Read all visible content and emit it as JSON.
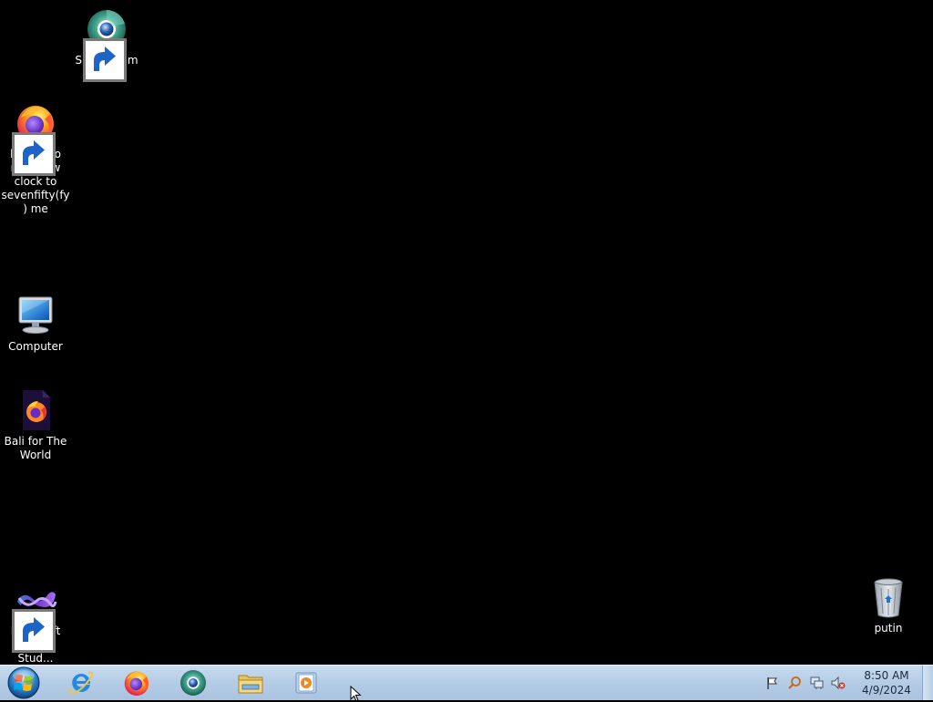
{
  "desktop": {
    "background_color": "#000000",
    "icons": [
      {
        "label": "Supermium",
        "icon": "supermium-icon",
        "shortcut": true
      },
      {
        "label": "haha i do not allow clock to sevenfifty(fy) me",
        "icon": "firefox-icon",
        "shortcut": true
      },
      {
        "label": "Computer",
        "icon": "computer-icon",
        "shortcut": false
      },
      {
        "label": "Bali for The World",
        "icon": "firefox-document-icon",
        "shortcut": false
      },
      {
        "label": "Microsoft Visual Stud...",
        "icon": "visual-studio-icon",
        "shortcut": true
      },
      {
        "label": "putin",
        "icon": "recycle-bin-icon",
        "shortcut": false
      }
    ]
  },
  "taskbar": {
    "start_icon": "windows-start-orb-icon",
    "pinned": [
      {
        "name": "internet-explorer",
        "icon": "internet-explorer-icon"
      },
      {
        "name": "firefox",
        "icon": "firefox-icon"
      },
      {
        "name": "supermium",
        "icon": "supermium-icon"
      },
      {
        "name": "windows-explorer",
        "icon": "folder-icon"
      },
      {
        "name": "media-player",
        "icon": "media-player-icon"
      }
    ],
    "tray": {
      "icons": [
        "action-center-flag-icon",
        "search-icon",
        "network-icon",
        "volume-muted-icon"
      ]
    },
    "clock": {
      "time": "8:50 AM",
      "date": "4/9/2024"
    }
  },
  "colors": {
    "taskbar_top": "#c9dcef",
    "taskbar_bottom": "#a9c3e0",
    "clock_text": "#1b2a3c",
    "desktop_label": "#ffffff"
  }
}
